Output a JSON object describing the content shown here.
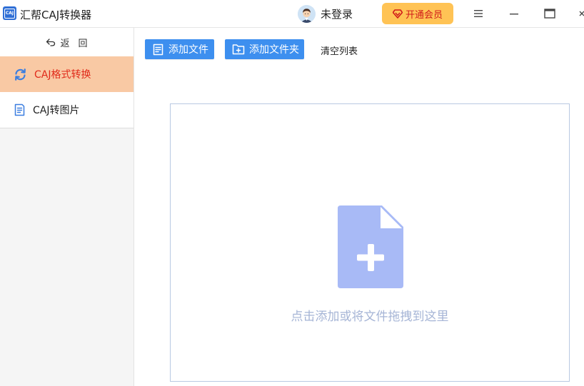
{
  "app": {
    "logo_text": "CAJ",
    "title": "汇帮CAJ转换器"
  },
  "user": {
    "name": "未登录"
  },
  "vip": {
    "label": "开通会员"
  },
  "sidebar": {
    "back_label": "返回",
    "items": [
      {
        "label": "CAJ格式转换",
        "icon": "refresh-icon",
        "active": true
      },
      {
        "label": "CAJ转图片",
        "icon": "document-icon",
        "active": false
      }
    ]
  },
  "toolbar": {
    "add_file_label": "添加文件",
    "add_folder_label": "添加文件夹",
    "clear_label": "清空列表"
  },
  "dropzone": {
    "hint": "点击添加或将文件拖拽到这里"
  },
  "colors": {
    "primary_button": "#3d8fef",
    "active_nav_bg": "#f9c9a4",
    "active_nav_text": "#e02a1a",
    "vip_bg": "#ffc355",
    "vip_text": "#d01a1a",
    "drop_icon": "#a8baf6",
    "drop_text": "#a6b5d6"
  }
}
